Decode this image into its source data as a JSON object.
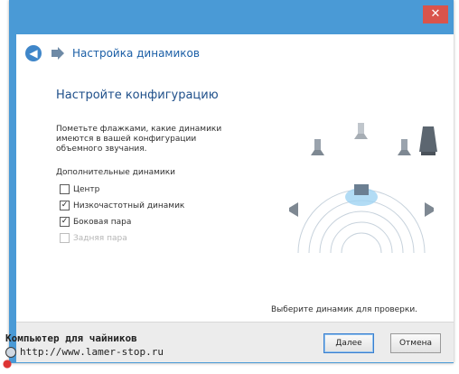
{
  "window": {
    "close_glyph": "✕",
    "title": "Настройка динамиков"
  },
  "content": {
    "heading": "Настройте конфигурацию",
    "description": "Пометьте флажками, какие динамики имеются в вашей конфигурации объемного звучания.",
    "section_label": "Дополнительные динамики",
    "options": [
      {
        "label": "Центр",
        "checked": false,
        "disabled": false
      },
      {
        "label": "Низкочастотный динамик",
        "checked": true,
        "disabled": false
      },
      {
        "label": "Боковая пара",
        "checked": true,
        "disabled": false
      },
      {
        "label": "Задняя пара",
        "checked": false,
        "disabled": true
      }
    ],
    "test_hint": "Выберите динамик для проверки."
  },
  "footer": {
    "next_label": "Далее",
    "cancel_label": "Отмена"
  },
  "watermark": {
    "line1": "Компьютер для чайников",
    "line2": "http://www.lamer-stop.ru"
  },
  "colors": {
    "titlebar": "#4a9ad6",
    "close": "#d9544c",
    "accent": "#1e4f8a"
  }
}
